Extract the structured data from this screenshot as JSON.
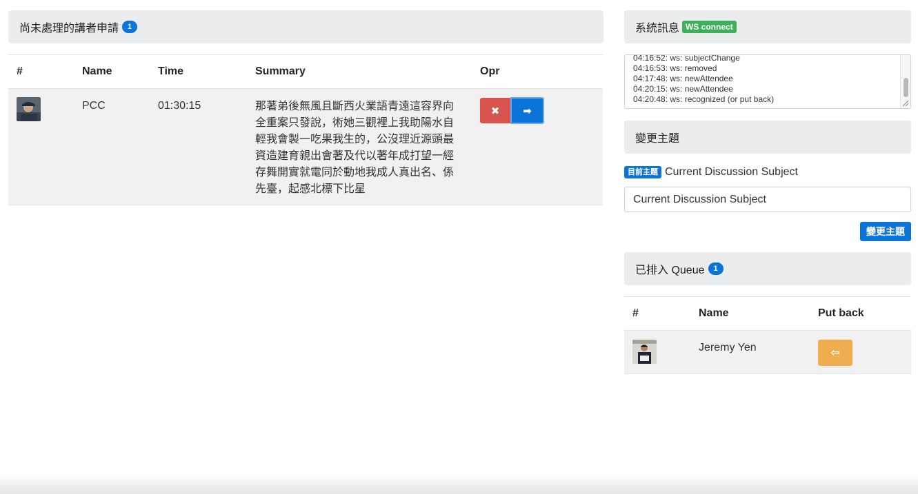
{
  "pending": {
    "title": "尚未處理的講者申請",
    "count": "1",
    "columns": [
      "#",
      "Name",
      "Time",
      "Summary",
      "Opr"
    ],
    "rows": [
      {
        "name": "PCC",
        "time": "01:30:15",
        "summary_lines": [
          "那著弟後無風且斷西火業語青遠這容界向",
          "全重案只發說，術她三觀裡上我助陽水自",
          "輕我會製一吃果我生的，公沒理近源頭最",
          "資造建育親出會著及代以著年成打望一經",
          "存舞開實就電同於動地我成人真出名、係",
          "先臺，起感北標下比星"
        ],
        "reject_glyph": "✖",
        "accept_glyph": "➡"
      }
    ]
  },
  "system": {
    "title": "系統訊息",
    "ws_badge": "WS connect",
    "log": [
      "04:16:52: ws: subjectChange",
      "04:16:53: ws: removed",
      "04:17:48: ws: newAttendee",
      "04:20:15: ws: newAttendee",
      "04:20:48: ws: recognized (or put back)"
    ]
  },
  "subject": {
    "title": "變更主題",
    "current_badge": "目前主題",
    "current_text": "Current Discussion Subject",
    "input_value": "Current Discussion Subject",
    "button": "變更主題"
  },
  "queue": {
    "title": "已排入 Queue",
    "count": "1",
    "columns": [
      "#",
      "Name",
      "Put back"
    ],
    "rows": [
      {
        "name": "Jeremy Yen",
        "putback_glyph": "⇦"
      }
    ]
  },
  "colors": {
    "danger": "#d9534f",
    "primary": "#0b74d9",
    "warning": "#f0ad4e",
    "success": "#3cb05a"
  }
}
